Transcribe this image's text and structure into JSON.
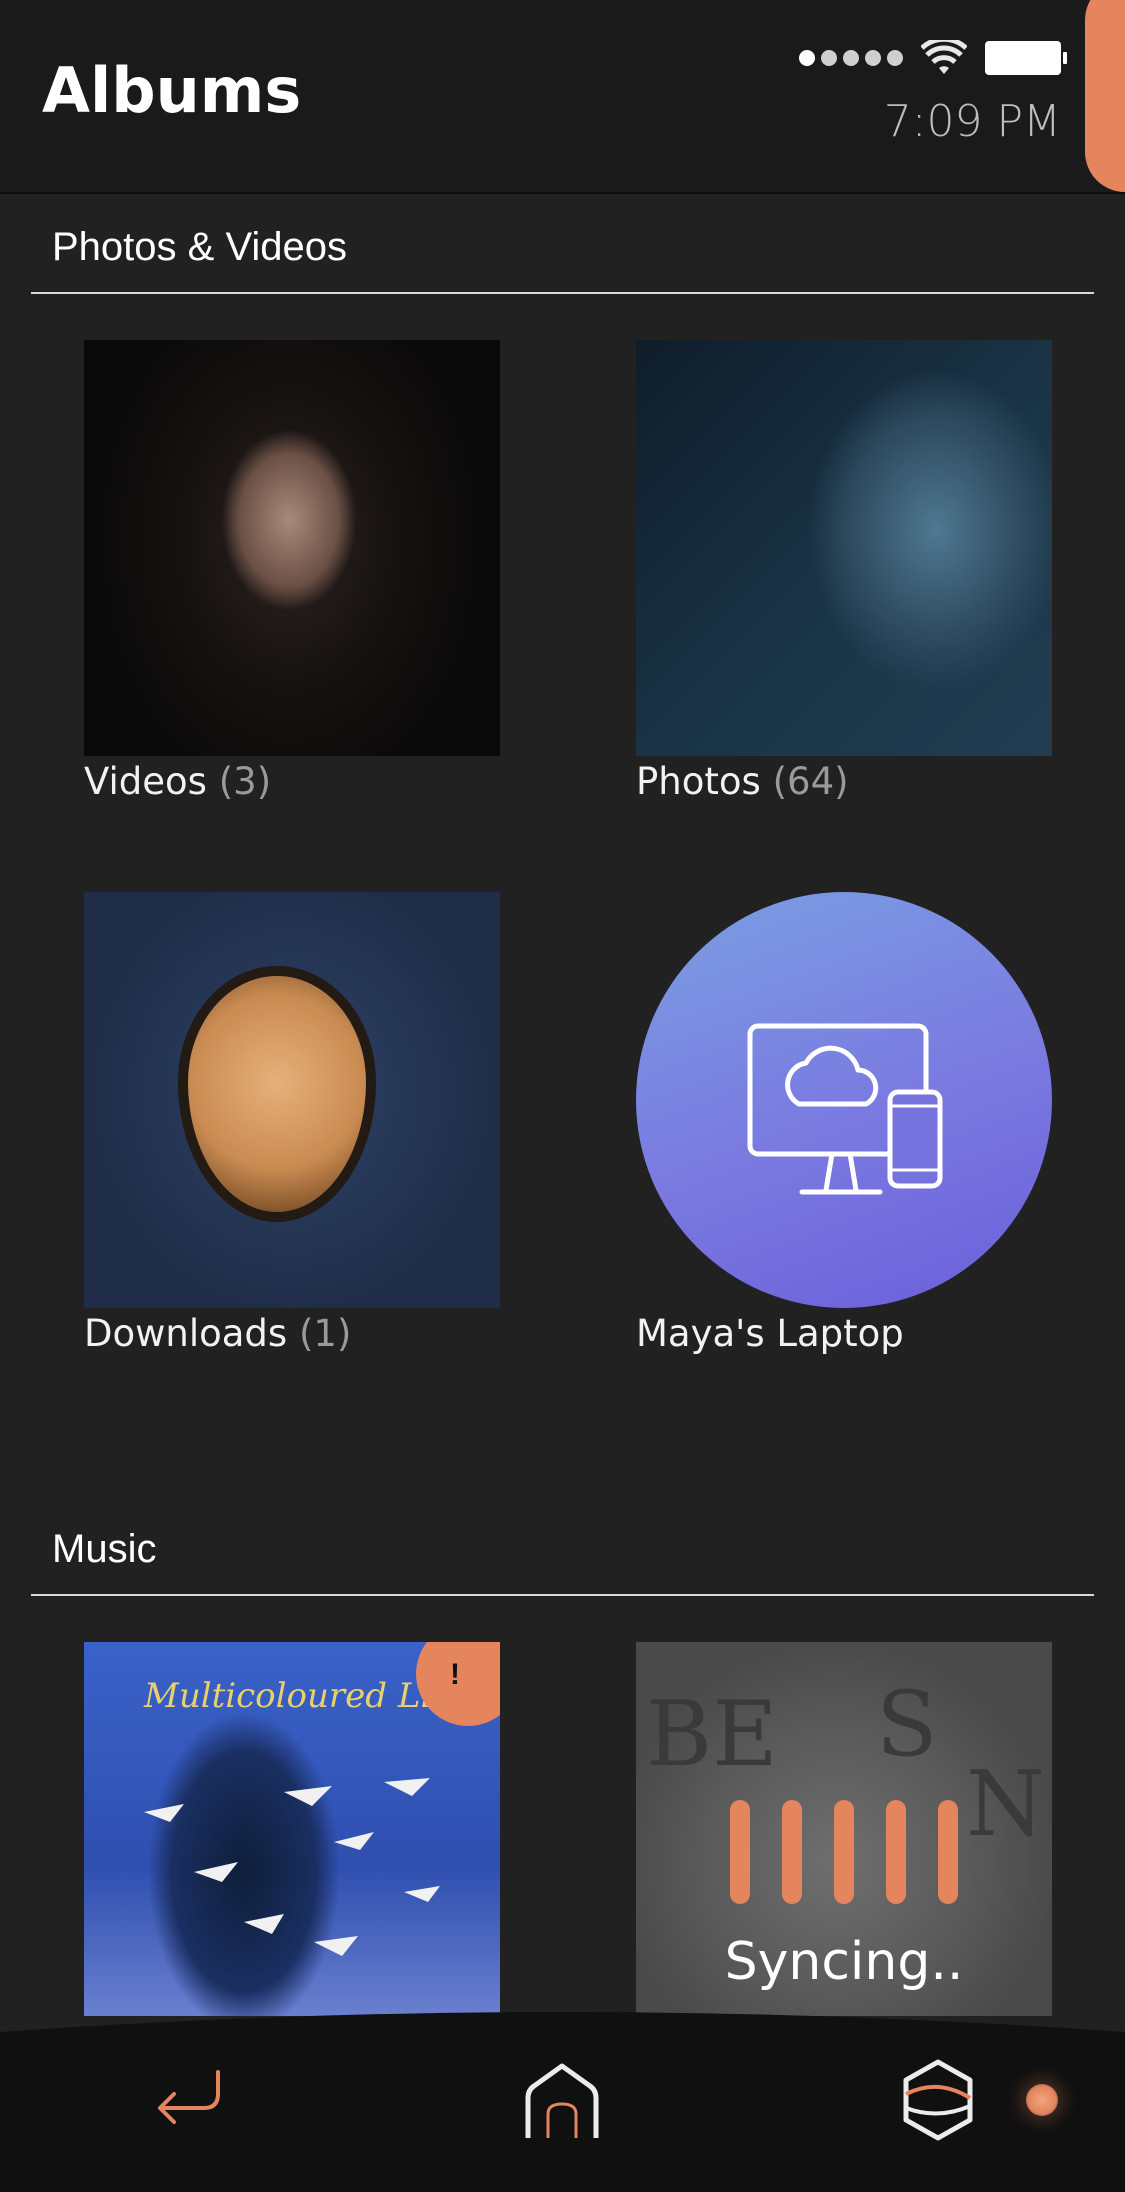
{
  "header": {
    "title": "Albums",
    "time": "7:09 PM",
    "signal_bars_on": 1,
    "signal_bars_total": 5
  },
  "sections": {
    "photos_videos": {
      "label": "Photos & Videos",
      "tiles": [
        {
          "name": "Videos",
          "count": "(3)"
        },
        {
          "name": "Photos",
          "count": "(64)"
        },
        {
          "name": "Downloads",
          "count": "(1)"
        },
        {
          "name": "Maya's Laptop",
          "count": ""
        }
      ]
    },
    "music": {
      "label": "Music",
      "tiles": [
        {
          "album_title": "Multicoloured Lies",
          "alert": "!"
        },
        {
          "status": "Syncing.."
        }
      ]
    }
  },
  "colors": {
    "accent": "#e4855d",
    "background": "#222121",
    "header": "#1a1a1a"
  },
  "nav": {
    "back_icon": "back-arrow-icon",
    "home_icon": "home-icon",
    "apps_icon": "cube-icon"
  }
}
